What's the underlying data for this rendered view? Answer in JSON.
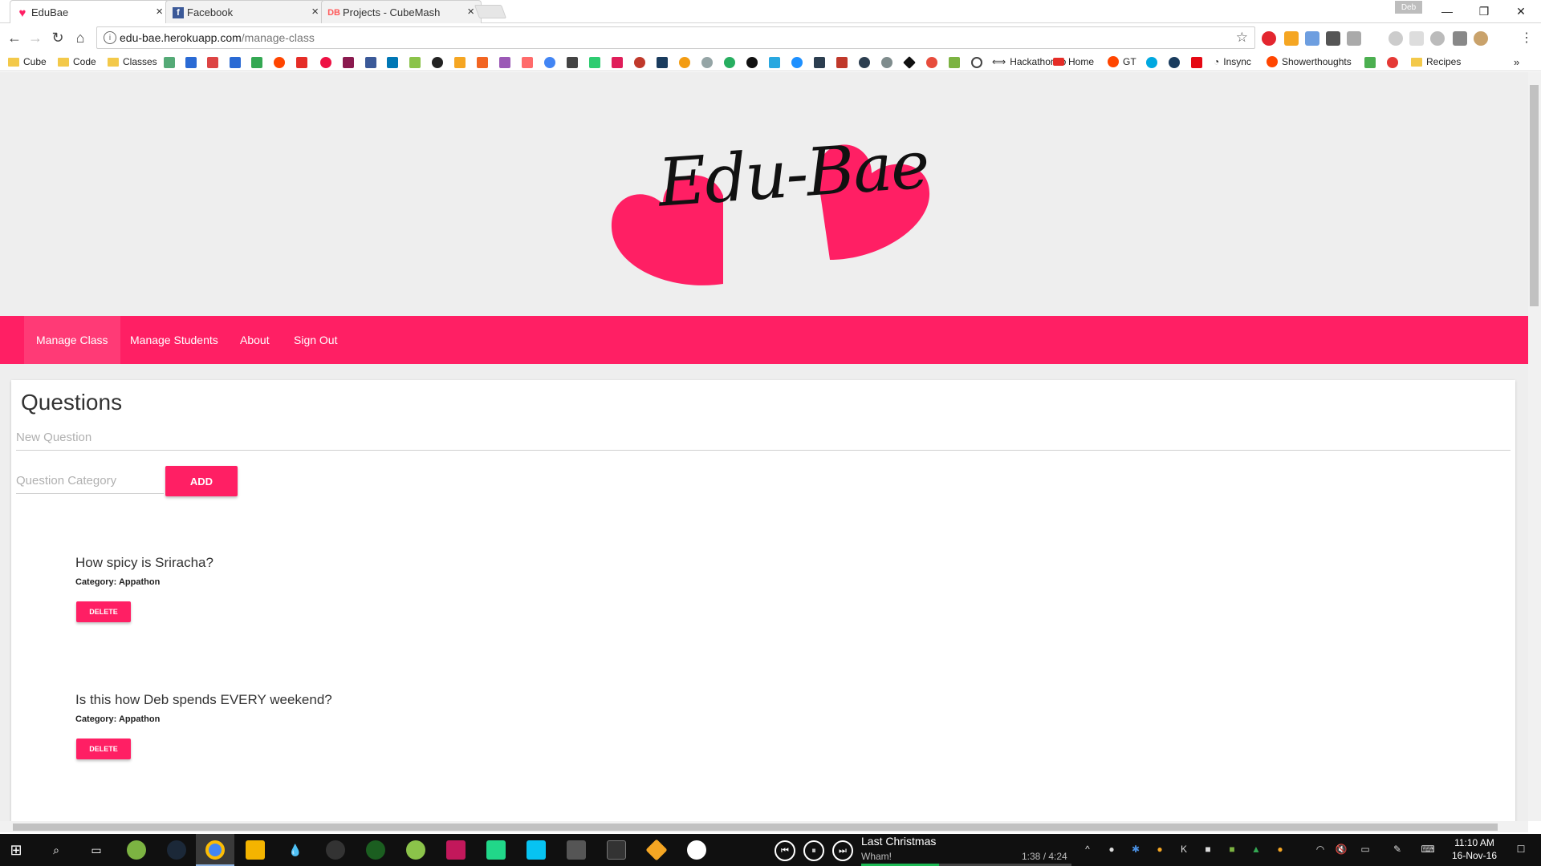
{
  "browser": {
    "tabs": [
      {
        "title": "EduBae",
        "active": true,
        "icon": "heart-icon"
      },
      {
        "title": "Facebook",
        "active": false,
        "icon": "facebook-icon"
      },
      {
        "title": "Projects - CubeMash",
        "active": false,
        "icon": "db-icon"
      }
    ],
    "user_badge": "Deb",
    "url_host": "edu-bae.herokuapp.com",
    "url_path": "/manage-class",
    "bookmarks": [
      {
        "label": "Cube",
        "icon": "folder-icon"
      },
      {
        "label": "Code",
        "icon": "folder-icon"
      },
      {
        "label": "Classes",
        "icon": "folder-icon"
      },
      {
        "label": "Hackathon.io",
        "icon": "hackathon-icon"
      },
      {
        "label": "Home",
        "icon": "youtube-icon"
      },
      {
        "label": "GT",
        "icon": "reddit-icon"
      },
      {
        "label": "Insync",
        "icon": "insync-icon"
      },
      {
        "label": "Showerthoughts",
        "icon": "reddit-icon"
      },
      {
        "label": "Recipes",
        "icon": "folder-icon"
      }
    ]
  },
  "site": {
    "logo_text": "Edu-Bae",
    "accent": "#ff1f64",
    "nav": [
      {
        "label": "Manage Class",
        "active": true
      },
      {
        "label": "Manage Students",
        "active": false
      },
      {
        "label": "About",
        "active": false
      },
      {
        "label": "Sign Out",
        "active": false
      }
    ]
  },
  "questions_panel": {
    "title": "Questions",
    "new_question_placeholder": "New Question",
    "category_placeholder": "Question Category",
    "add_label": "ADD",
    "items": [
      {
        "question": "How spicy is Sriracha?",
        "category": "Category: Appathon",
        "delete_label": "DELETE"
      },
      {
        "question": "Is this how Deb spends EVERY weekend?",
        "category": "Category: Appathon",
        "delete_label": "DELETE"
      }
    ]
  },
  "taskbar": {
    "media": {
      "title": "Last Christmas",
      "artist": "Wham!",
      "time": "1:38 / 4:24",
      "progress": 0.37
    },
    "clock_time": "11:10 AM",
    "clock_date": "16-Nov-16"
  }
}
